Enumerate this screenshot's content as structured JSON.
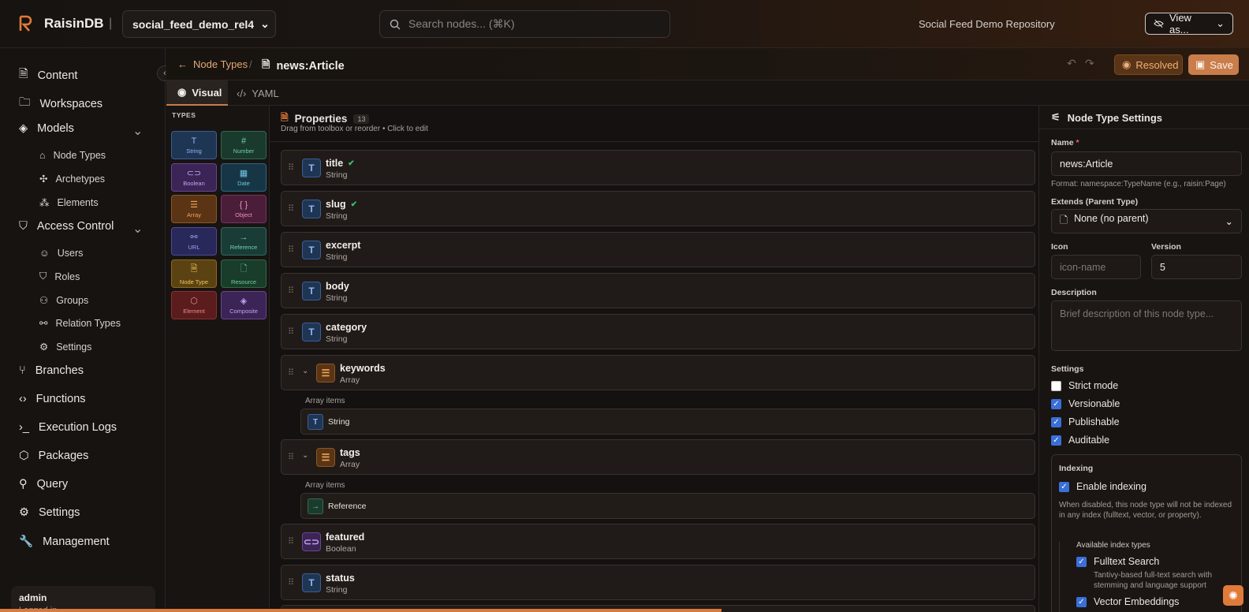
{
  "header": {
    "brand": "RaisinDB",
    "repo_selector": "social_feed_demo_rel4",
    "search_placeholder": "Search nodes... (⌘K)",
    "repo_title": "Social Feed Demo Repository",
    "view_as": "View as..."
  },
  "sidebar": {
    "items": [
      {
        "label": "Content"
      },
      {
        "label": "Workspaces"
      },
      {
        "label": "Models"
      },
      {
        "label": "Access Control"
      },
      {
        "label": "Branches"
      },
      {
        "label": "Functions"
      },
      {
        "label": "Execution Logs"
      },
      {
        "label": "Packages"
      },
      {
        "label": "Query"
      },
      {
        "label": "Settings"
      },
      {
        "label": "Management"
      }
    ],
    "models_sub": [
      "Node Types",
      "Archetypes",
      "Elements"
    ],
    "access_sub": [
      "Users",
      "Roles",
      "Groups",
      "Relation Types",
      "Settings"
    ],
    "user": {
      "name": "admin",
      "status": "Logged in"
    }
  },
  "breadcrumb": {
    "back": "Node Types",
    "sep": "/",
    "current": "news:Article"
  },
  "actions": {
    "resolved": "Resolved",
    "save": "Save"
  },
  "tabs": {
    "visual": "Visual",
    "yaml": "YAML"
  },
  "toolbox": {
    "title": "TYPES",
    "types": [
      "String",
      "Number",
      "Boolean",
      "Date",
      "Array",
      "Object",
      "URL",
      "Reference",
      "Node Type",
      "Resource",
      "Element",
      "Composite"
    ]
  },
  "properties": {
    "title": "Properties",
    "count": "13",
    "hint": "Drag from toolbox or reorder • Click to edit",
    "array_items_label": "Array items",
    "list": [
      {
        "name": "title",
        "type": "String"
      },
      {
        "name": "slug",
        "type": "String"
      },
      {
        "name": "excerpt",
        "type": "String"
      },
      {
        "name": "body",
        "type": "String"
      },
      {
        "name": "category",
        "type": "String"
      },
      {
        "name": "keywords",
        "type": "Array",
        "item": "String"
      },
      {
        "name": "tags",
        "type": "Array",
        "item": "Reference"
      },
      {
        "name": "featured",
        "type": "Boolean"
      },
      {
        "name": "status",
        "type": "String"
      }
    ]
  },
  "node_settings": {
    "title": "Node Type Settings",
    "name_label": "Name",
    "name_required": "*",
    "name_value": "news:Article",
    "name_hint": "Format: namespace:TypeName (e.g., raisin:Page)",
    "extends_label": "Extends (Parent Type)",
    "extends_value": "None (no parent)",
    "icon_label": "Icon",
    "icon_placeholder": "icon-name",
    "version_label": "Version",
    "version_value": "5",
    "description_label": "Description",
    "description_placeholder": "Brief description of this node type...",
    "settings_label": "Settings",
    "flags": [
      {
        "label": "Strict mode",
        "checked": false
      },
      {
        "label": "Versionable",
        "checked": true
      },
      {
        "label": "Publishable",
        "checked": true
      },
      {
        "label": "Auditable",
        "checked": true
      }
    ],
    "indexing": {
      "title": "Indexing",
      "enable": "Enable indexing",
      "desc": "When disabled, this node type will not be indexed in any index (fulltext, vector, or property).",
      "available": "Available index types",
      "fulltext": "Fulltext Search",
      "fulltext_desc": "Tantivy-based full-text search with stemming and language support",
      "vector": "Vector Embeddings"
    }
  }
}
